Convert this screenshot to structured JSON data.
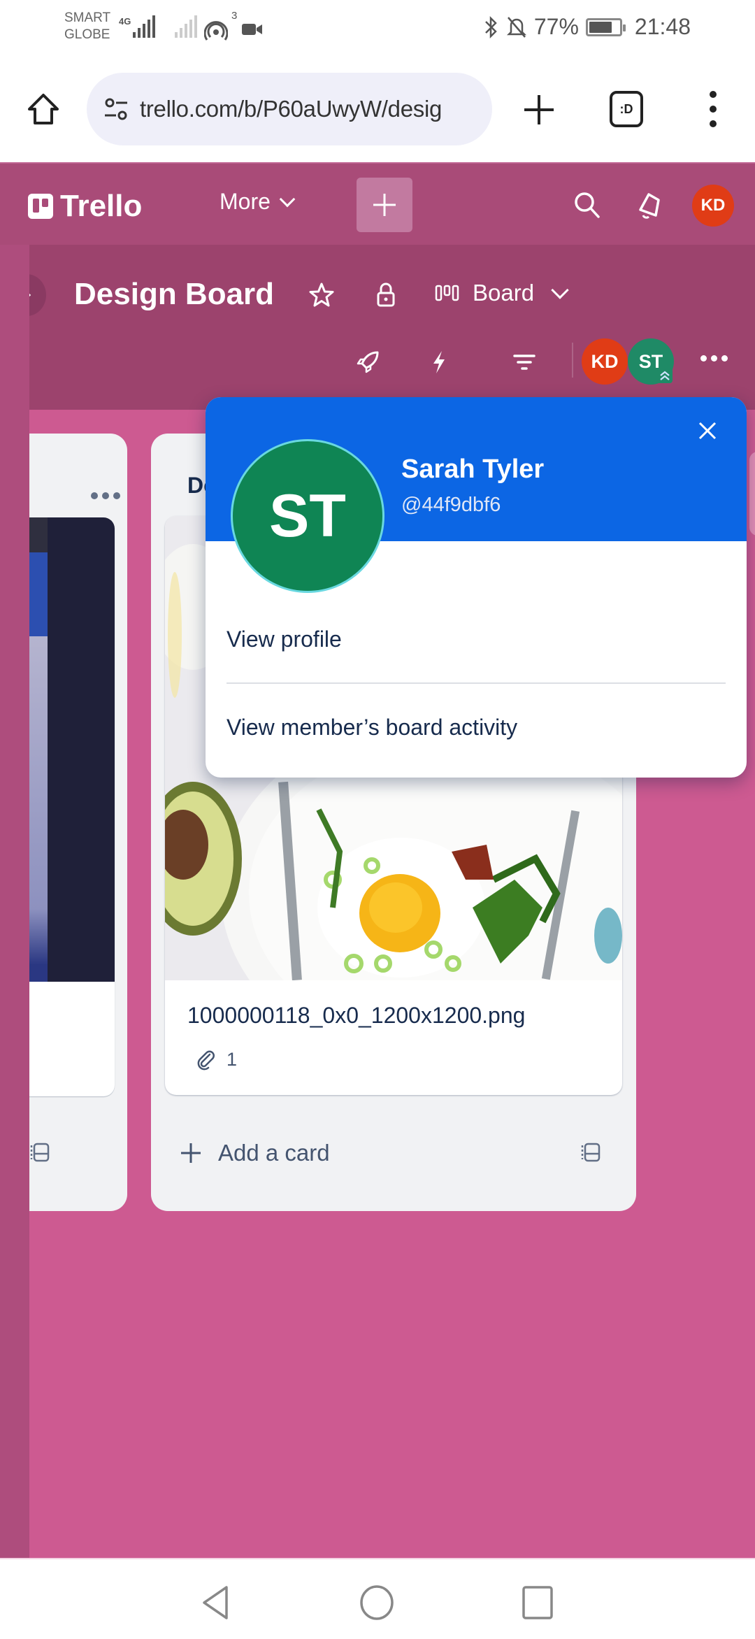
{
  "status_bar": {
    "carrier_line1": "SMART",
    "carrier_line2": "GLOBE",
    "network_type": "4G",
    "hotspot_count": "3",
    "battery_percent": "77%",
    "battery_level": 0.77,
    "time": "21:48",
    "icons": [
      "signal-icon",
      "signal-weak-icon",
      "hotspot-icon",
      "video-camera-icon",
      "bluetooth-icon",
      "bell-muted-icon",
      "battery-icon"
    ]
  },
  "browser": {
    "url": "trello.com/b/P60aUwyW/desig",
    "tabs_label": ":D",
    "icons": [
      "home-icon",
      "site-settings-icon",
      "new-tab-icon",
      "tab-switcher-icon",
      "menu-icon"
    ]
  },
  "trello_header": {
    "logo_text": "Trello",
    "more_label": "More",
    "user_initials": "KD",
    "colors": {
      "header_bg": "#a94b78",
      "user_avatar": "#e03c16"
    }
  },
  "board_header": {
    "title": "Design Board",
    "view_label": "Board",
    "members": [
      {
        "initials": "KD",
        "color": "#e03c16"
      },
      {
        "initials": "ST",
        "color": "#1f8a66",
        "admin": true
      }
    ],
    "colors": {
      "board_header_bg": "#9c436d",
      "board_bg": "#cd5a91"
    }
  },
  "lists": [
    {
      "title": "",
      "menu_label": "List actions",
      "cards": [
        {
          "cover": "dark-screenshot"
        }
      ]
    },
    {
      "title": "Do",
      "cards": [
        {
          "name": "1000000118_0x0_1200x1200.png",
          "cover": "food-photo",
          "attachments": "1"
        }
      ],
      "add_card_label": "Add a card"
    }
  ],
  "member_popover": {
    "initials": "ST",
    "full_name": "Sarah Tyler",
    "username": "@44f9dbf6",
    "menu": [
      {
        "label": "View profile"
      },
      {
        "label": "View member’s board activity"
      }
    ],
    "colors": {
      "header": "#0c66e4",
      "avatar": "#0f8554"
    }
  },
  "nav_bar": {
    "buttons": [
      "back",
      "home",
      "recents"
    ]
  }
}
